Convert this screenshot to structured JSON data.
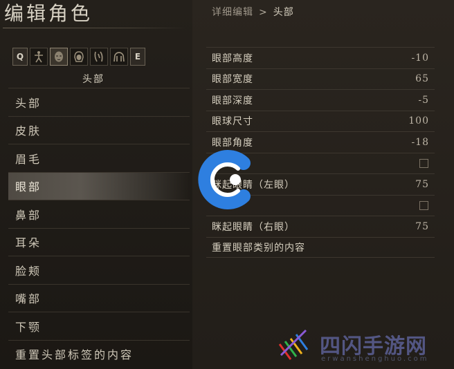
{
  "header": {
    "title": "编辑角色",
    "breadcrumb_parent": "详细编辑",
    "breadcrumb_sep": ">",
    "breadcrumb_current": "头部"
  },
  "tabs": {
    "left_key": "Q",
    "right_key": "E",
    "icons": [
      "body-figure-icon",
      "face-icon",
      "hair-icon",
      "limbs-icon",
      "torso-icon"
    ],
    "active_index": 1
  },
  "section_label": "头部",
  "categories": [
    {
      "label": "头部"
    },
    {
      "label": "皮肤"
    },
    {
      "label": "眉毛"
    },
    {
      "label": "眼部",
      "active": true
    },
    {
      "label": "鼻部"
    },
    {
      "label": "耳朵"
    },
    {
      "label": "脸颊"
    },
    {
      "label": "嘴部"
    },
    {
      "label": "下颚"
    },
    {
      "label": "重置头部标签的内容"
    }
  ],
  "detail": {
    "rows": [
      {
        "label": "眼部高度",
        "value": "-10"
      },
      {
        "label": "眼部宽度",
        "value": "65"
      },
      {
        "label": "眼部深度",
        "value": "-5"
      },
      {
        "label": "眼球尺寸",
        "value": "100"
      },
      {
        "label": "眼部角度",
        "value": "-18"
      },
      {
        "label": "",
        "checkbox": false
      },
      {
        "label": "眯起眼睛（左眼）",
        "value": "75"
      },
      {
        "label": "",
        "checkbox": false
      },
      {
        "label": "眯起眼睛（右眼）",
        "value": "75"
      }
    ],
    "reset_label": "重置眼部类别的内容"
  },
  "watermark": {
    "text": "四闪手游网",
    "sub": "erwanshenghuo.com"
  },
  "colors": {
    "accent_blue": "#2e7fe0",
    "panel_dark": "#1b1814",
    "text_light": "#d6cfbf"
  }
}
